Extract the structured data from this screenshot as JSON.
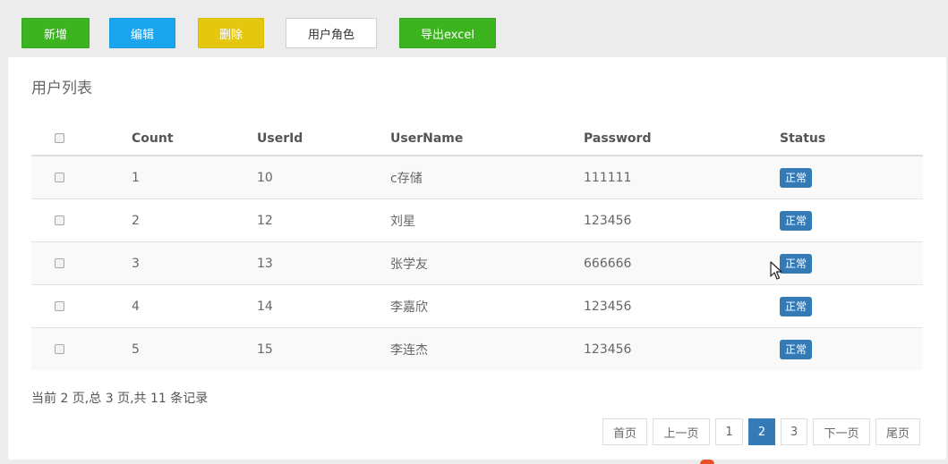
{
  "toolbar": {
    "add": "新增",
    "edit": "编辑",
    "delete": "删除",
    "user_role": "用户角色",
    "export": "导出excel"
  },
  "panel": {
    "title": "用户列表"
  },
  "table": {
    "headers": [
      "Count",
      "UserId",
      "UserName",
      "Password",
      "Status"
    ],
    "rows": [
      {
        "count": "1",
        "userid": "10",
        "username": "c存储",
        "password": "111111",
        "status": "正常"
      },
      {
        "count": "2",
        "userid": "12",
        "username": "刘星",
        "password": "123456",
        "status": "正常"
      },
      {
        "count": "3",
        "userid": "13",
        "username": "张学友",
        "password": "666666",
        "status": "正常"
      },
      {
        "count": "4",
        "userid": "14",
        "username": "李嘉欣",
        "password": "123456",
        "status": "正常"
      },
      {
        "count": "5",
        "userid": "15",
        "username": "李连杰",
        "password": "123456",
        "status": "正常"
      }
    ]
  },
  "summary": "当前 2 页,总 3 页,共 11 条记录",
  "pagination": {
    "first": "首页",
    "prev": "上一页",
    "pages": [
      "1",
      "2",
      "3"
    ],
    "current": "2",
    "next": "下一页",
    "last": "尾页"
  },
  "colors": {
    "green": "#3cb41f",
    "blue": "#1aa6ef",
    "yellow": "#e6c710",
    "badge": "#337ab7"
  }
}
